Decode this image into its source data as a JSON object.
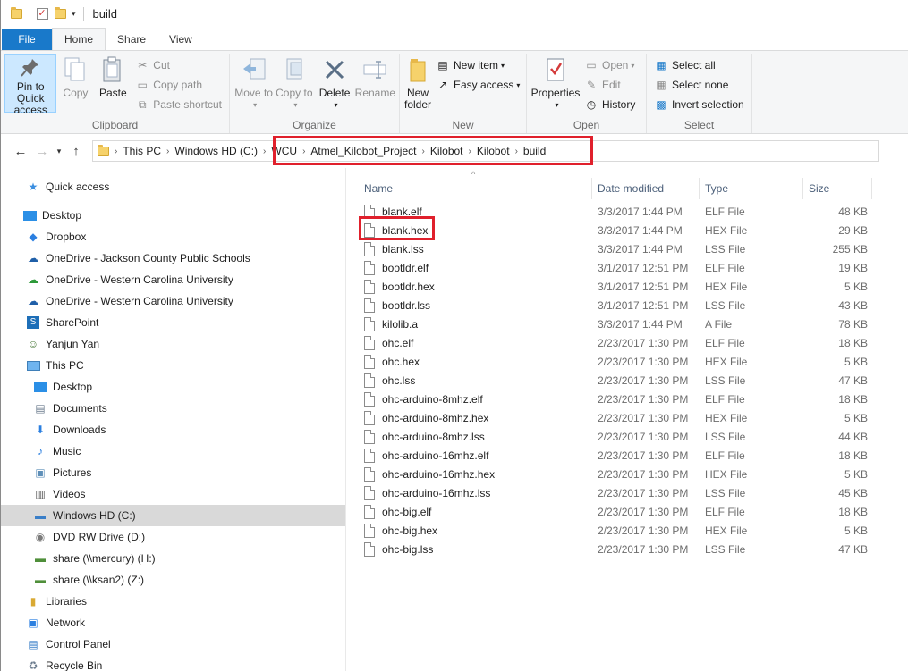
{
  "window": {
    "title": "build"
  },
  "tabs": [
    "File",
    "Home",
    "Share",
    "View"
  ],
  "ribbon": {
    "clipboard": {
      "label": "Clipboard",
      "pin": "Pin to Quick access",
      "copy": "Copy",
      "paste": "Paste",
      "cut": "Cut",
      "copy_path": "Copy path",
      "paste_shortcut": "Paste shortcut"
    },
    "organize": {
      "label": "Organize",
      "move_to": "Move to",
      "copy_to": "Copy to",
      "delete": "Delete",
      "rename": "Rename"
    },
    "new": {
      "label": "New",
      "new_folder": "New folder",
      "new_item": "New item",
      "easy_access": "Easy access"
    },
    "open": {
      "label": "Open",
      "properties": "Properties",
      "open": "Open",
      "edit": "Edit",
      "history": "History"
    },
    "select": {
      "label": "Select",
      "select_all": "Select all",
      "select_none": "Select none",
      "invert": "Invert selection"
    }
  },
  "address": {
    "crumbs": [
      "This PC",
      "Windows HD (C:)",
      "WCU",
      "Atmel_Kilobot_Project",
      "Kilobot",
      "Kilobot",
      "build"
    ]
  },
  "nav": {
    "quick_access": "Quick access",
    "desktop": "Desktop",
    "dropbox": "Dropbox",
    "onedrive1": "OneDrive - Jackson County Public Schools",
    "onedrive2": "OneDrive - Western Carolina University",
    "onedrive3": "OneDrive - Western Carolina University",
    "sharepoint": "SharePoint",
    "user": "Yanjun Yan",
    "this_pc": "This PC",
    "pc_desktop": "Desktop",
    "documents": "Documents",
    "downloads": "Downloads",
    "music": "Music",
    "pictures": "Pictures",
    "videos": "Videos",
    "windows_hd": "Windows HD (C:)",
    "dvd": "DVD RW Drive (D:)",
    "share_h": "share (\\\\mercury) (H:)",
    "share_z": "share (\\\\ksan2) (Z:)",
    "libraries": "Libraries",
    "network": "Network",
    "control_panel": "Control Panel",
    "recycle_bin": "Recycle Bin"
  },
  "columns": {
    "name": "Name",
    "date": "Date modified",
    "type": "Type",
    "size": "Size"
  },
  "files": [
    {
      "name": "blank.elf",
      "date": "3/3/2017 1:44 PM",
      "type": "ELF File",
      "size": "48 KB"
    },
    {
      "name": "blank.hex",
      "date": "3/3/2017 1:44 PM",
      "type": "HEX File",
      "size": "29 KB"
    },
    {
      "name": "blank.lss",
      "date": "3/3/2017 1:44 PM",
      "type": "LSS File",
      "size": "255 KB"
    },
    {
      "name": "bootldr.elf",
      "date": "3/1/2017 12:51 PM",
      "type": "ELF File",
      "size": "19 KB"
    },
    {
      "name": "bootldr.hex",
      "date": "3/1/2017 12:51 PM",
      "type": "HEX File",
      "size": "5 KB"
    },
    {
      "name": "bootldr.lss",
      "date": "3/1/2017 12:51 PM",
      "type": "LSS File",
      "size": "43 KB"
    },
    {
      "name": "kilolib.a",
      "date": "3/3/2017 1:44 PM",
      "type": "A File",
      "size": "78 KB"
    },
    {
      "name": "ohc.elf",
      "date": "2/23/2017 1:30 PM",
      "type": "ELF File",
      "size": "18 KB"
    },
    {
      "name": "ohc.hex",
      "date": "2/23/2017 1:30 PM",
      "type": "HEX File",
      "size": "5 KB"
    },
    {
      "name": "ohc.lss",
      "date": "2/23/2017 1:30 PM",
      "type": "LSS File",
      "size": "47 KB"
    },
    {
      "name": "ohc-arduino-8mhz.elf",
      "date": "2/23/2017 1:30 PM",
      "type": "ELF File",
      "size": "18 KB"
    },
    {
      "name": "ohc-arduino-8mhz.hex",
      "date": "2/23/2017 1:30 PM",
      "type": "HEX File",
      "size": "5 KB"
    },
    {
      "name": "ohc-arduino-8mhz.lss",
      "date": "2/23/2017 1:30 PM",
      "type": "LSS File",
      "size": "44 KB"
    },
    {
      "name": "ohc-arduino-16mhz.elf",
      "date": "2/23/2017 1:30 PM",
      "type": "ELF File",
      "size": "18 KB"
    },
    {
      "name": "ohc-arduino-16mhz.hex",
      "date": "2/23/2017 1:30 PM",
      "type": "HEX File",
      "size": "5 KB"
    },
    {
      "name": "ohc-arduino-16mhz.lss",
      "date": "2/23/2017 1:30 PM",
      "type": "LSS File",
      "size": "45 KB"
    },
    {
      "name": "ohc-big.elf",
      "date": "2/23/2017 1:30 PM",
      "type": "ELF File",
      "size": "18 KB"
    },
    {
      "name": "ohc-big.hex",
      "date": "2/23/2017 1:30 PM",
      "type": "HEX File",
      "size": "5 KB"
    },
    {
      "name": "ohc-big.lss",
      "date": "2/23/2017 1:30 PM",
      "type": "LSS File",
      "size": "47 KB"
    }
  ],
  "colors": {
    "accent": "#1979ca",
    "highlight": "#e0202c",
    "selected": "#d9d9d9"
  }
}
